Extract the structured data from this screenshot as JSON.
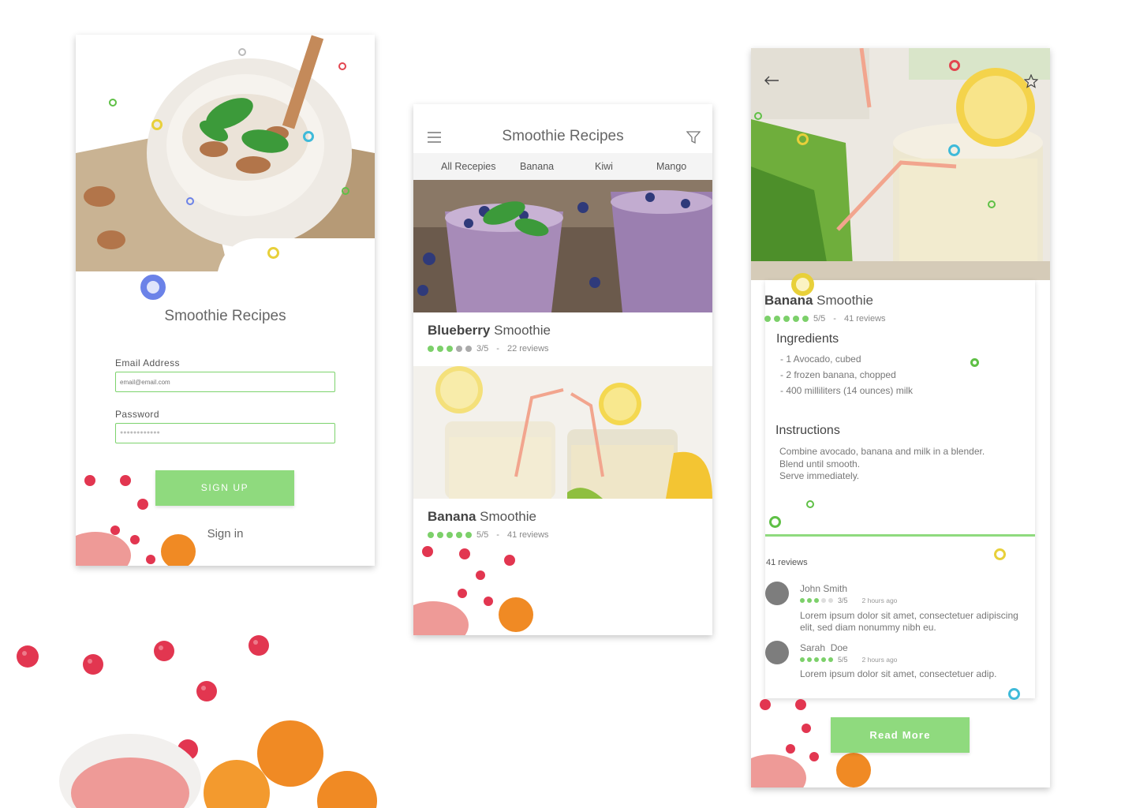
{
  "login": {
    "title": "Smoothie Recipes",
    "email_label": "Email Address",
    "email_placeholder": "email@email.com",
    "password_label": "Password",
    "password_value": "●●●●●●●●●●●●",
    "signup_label": "SIGN UP",
    "signin_label": "Sign in"
  },
  "list": {
    "title": "Smoothie Recipes",
    "tabs": [
      "All Recepies",
      "Banana",
      "Kiwi",
      "Mango"
    ],
    "cards": [
      {
        "name_bold": "Blueberry",
        "name_rest": "Smoothie",
        "rating": "3/5",
        "sep": "-",
        "reviews": "22 reviews",
        "stars": 3
      },
      {
        "name_bold": "Banana",
        "name_rest": "Smoothie",
        "rating": "5/5",
        "sep": "-",
        "reviews": "41 reviews",
        "stars": 5
      }
    ]
  },
  "detail": {
    "name_bold": "Banana",
    "name_rest": "Smoothie",
    "rating": "5/5",
    "sep": "-",
    "reviews": "41 reviews",
    "ingredients_title": "Ingredients",
    "ingredients": [
      "- 1 Avocado, cubed",
      "- 2 frozen banana, chopped",
      "- 400 milliliters (14 ounces) milk"
    ],
    "instructions_title": "Instructions",
    "instructions": [
      "Combine avocado, banana and milk in a blender.",
      "Blend until smooth.",
      "Serve immediately."
    ],
    "reviews_count": "41 reviews",
    "review_list": [
      {
        "name": "John Smith",
        "rating": "3/5",
        "time": "2 hours ago",
        "text": "Lorem ipsum dolor sit amet, consectetuer adipiscing elit, sed diam nonummy nibh eu.",
        "stars": 3
      },
      {
        "name": "Sarah  Doe",
        "rating": "5/5",
        "time": "2 hours ago",
        "text": "Lorem ipsum dolor sit amet, consectetuer adip.",
        "stars": 5
      }
    ],
    "read_more_label": "Read More"
  },
  "icons": {
    "menu": "menu-icon",
    "filter": "filter-icon",
    "back": "arrow-left-icon",
    "favorite": "star-icon"
  },
  "colors": {
    "accent_green": "#8fda7e",
    "rating_green": "#7cd06a",
    "input_border": "#7dd36d"
  }
}
